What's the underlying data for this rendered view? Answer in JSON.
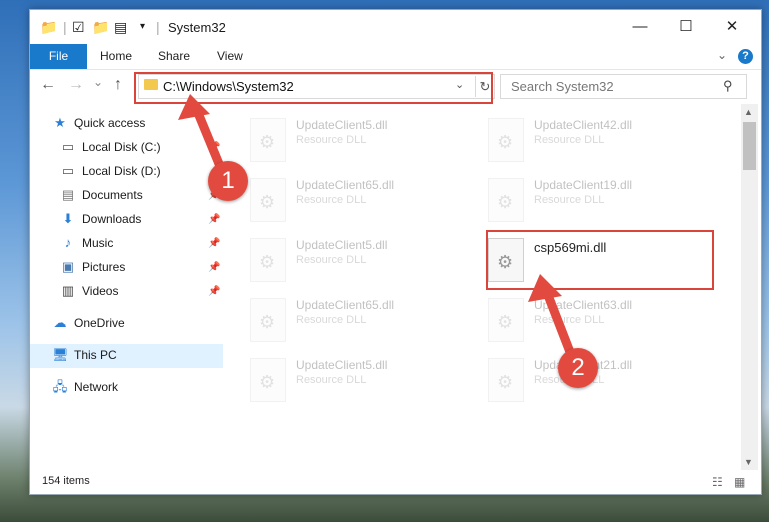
{
  "window": {
    "title": "System32",
    "minimize_glyph": "—",
    "maximize_glyph": "☐",
    "close_glyph": "✕"
  },
  "ribbon": {
    "file": "File",
    "home": "Home",
    "share": "Share",
    "view": "View",
    "help": "?"
  },
  "nav": {
    "back": "←",
    "forward": "→",
    "recent": "⌄",
    "up": "↑",
    "address": "C:\\Windows\\System32",
    "search_placeholder": "Search System32"
  },
  "sidebar": {
    "items": [
      {
        "label": "Quick access",
        "icon": "star-icon"
      },
      {
        "label": "Local Disk (C:)",
        "icon": "drive-icon"
      },
      {
        "label": "Local Disk (D:)",
        "icon": "drive-icon"
      },
      {
        "label": "Documents",
        "icon": "documents-icon"
      },
      {
        "label": "Downloads",
        "icon": "downloads-icon"
      },
      {
        "label": "Music",
        "icon": "music-icon"
      },
      {
        "label": "Pictures",
        "icon": "pictures-icon"
      },
      {
        "label": "Videos",
        "icon": "videos-icon"
      },
      {
        "label": "OneDrive",
        "icon": "cloud-icon"
      },
      {
        "label": "This PC",
        "icon": "pc-icon",
        "selected": true
      },
      {
        "label": "Network",
        "icon": "network-icon"
      }
    ]
  },
  "files": [
    {
      "name": "UpdateClient5.dll",
      "type": "Resource DLL"
    },
    {
      "name": "UpdateClient42.dll",
      "type": "Resource DLL"
    },
    {
      "name": "UpdateClient65.dll",
      "type": "Resource DLL"
    },
    {
      "name": "UpdateClient19.dll",
      "type": "Resource DLL"
    },
    {
      "name": "UpdateClient5.dll",
      "type": "Resource DLL"
    },
    {
      "name": "csp569mi.dll",
      "type": ""
    },
    {
      "name": "UpdateClient65.dll",
      "type": "Resource DLL"
    },
    {
      "name": "UpdateClient63.dll",
      "type": "Resource DLL"
    },
    {
      "name": "UpdateClient5.dll",
      "type": "Resource DLL"
    },
    {
      "name": "UpdateClient21.dll",
      "type": "Resource DLL"
    }
  ],
  "status": {
    "item_count": "154 items"
  },
  "annotations": {
    "step1": "1",
    "step2": "2",
    "color": "#d9453b"
  }
}
